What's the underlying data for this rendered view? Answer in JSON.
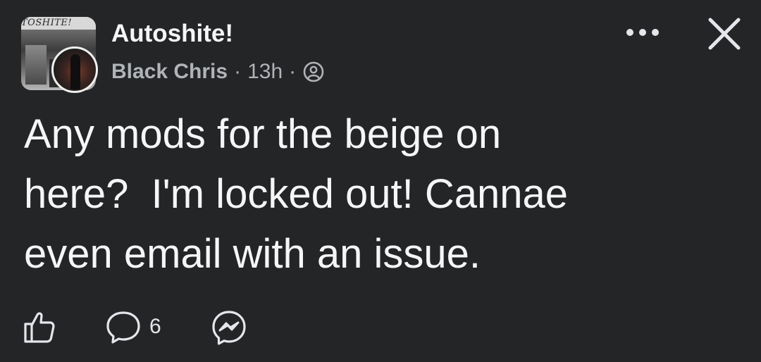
{
  "post": {
    "group_name": "Autoshite!",
    "group_avatar_text": "TOSHITE!",
    "author": "Black Chris",
    "separator": "·",
    "time": "13h",
    "audience_icon": "group-members-icon",
    "text": "Any mods for the beige on\nhere?  I'm locked out! Cannae\neven email with an issue.",
    "comment_count": "6"
  },
  "icons": {
    "more": "more-horizontal-icon",
    "close": "close-icon",
    "like": "thumbs-up-icon",
    "comment": "comment-bubble-icon",
    "share": "messenger-icon"
  },
  "colors": {
    "background": "#242526",
    "primary_text": "#f5f6f7",
    "secondary_text": "#b0b3b8"
  }
}
